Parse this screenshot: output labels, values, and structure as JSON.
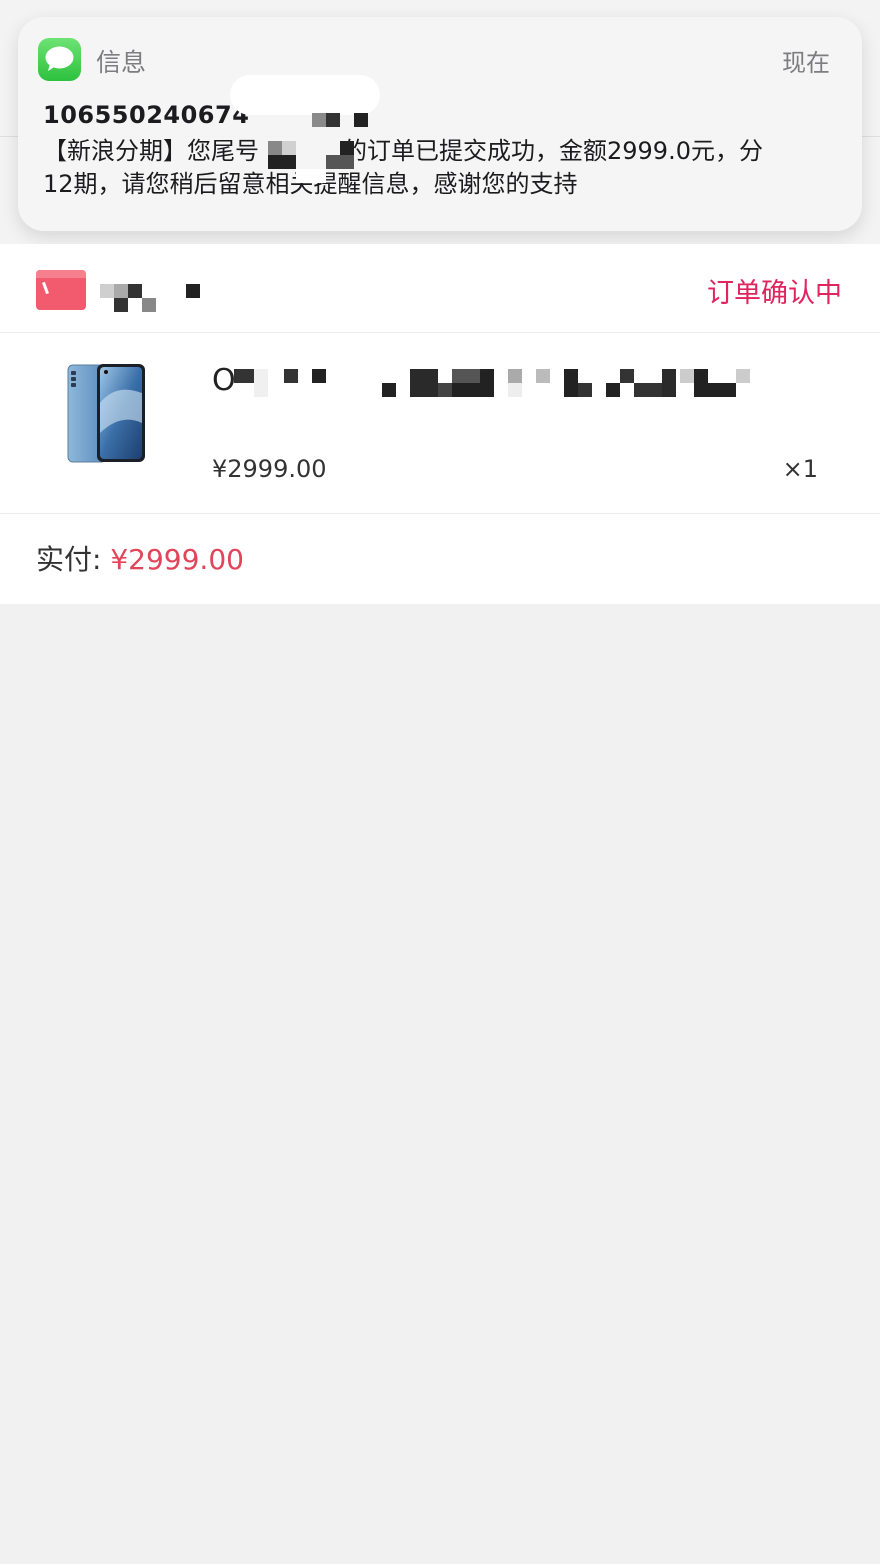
{
  "notification": {
    "app_name": "信息",
    "time": "现在",
    "sender": "106550240674",
    "body_line1": "【新浪分期】您尾号",
    "body_line1_cont": "的订单已提交成功，金额2999.0元，分",
    "body_line2": "12期，请您稍后留意相关提醒信息，感谢您的支持",
    "app_icon": "messages-icon",
    "accent_color": "#34c759"
  },
  "order": {
    "status": "订单确认中",
    "status_color": "#e0245e",
    "shop_icon": "shop-icon",
    "product": {
      "title_prefix": "O",
      "price": "¥2999.00",
      "quantity": "×1",
      "image": "phone-image"
    },
    "total_label": "实付: ",
    "total_amount": "¥2999.00",
    "total_color": "#e0455a"
  }
}
